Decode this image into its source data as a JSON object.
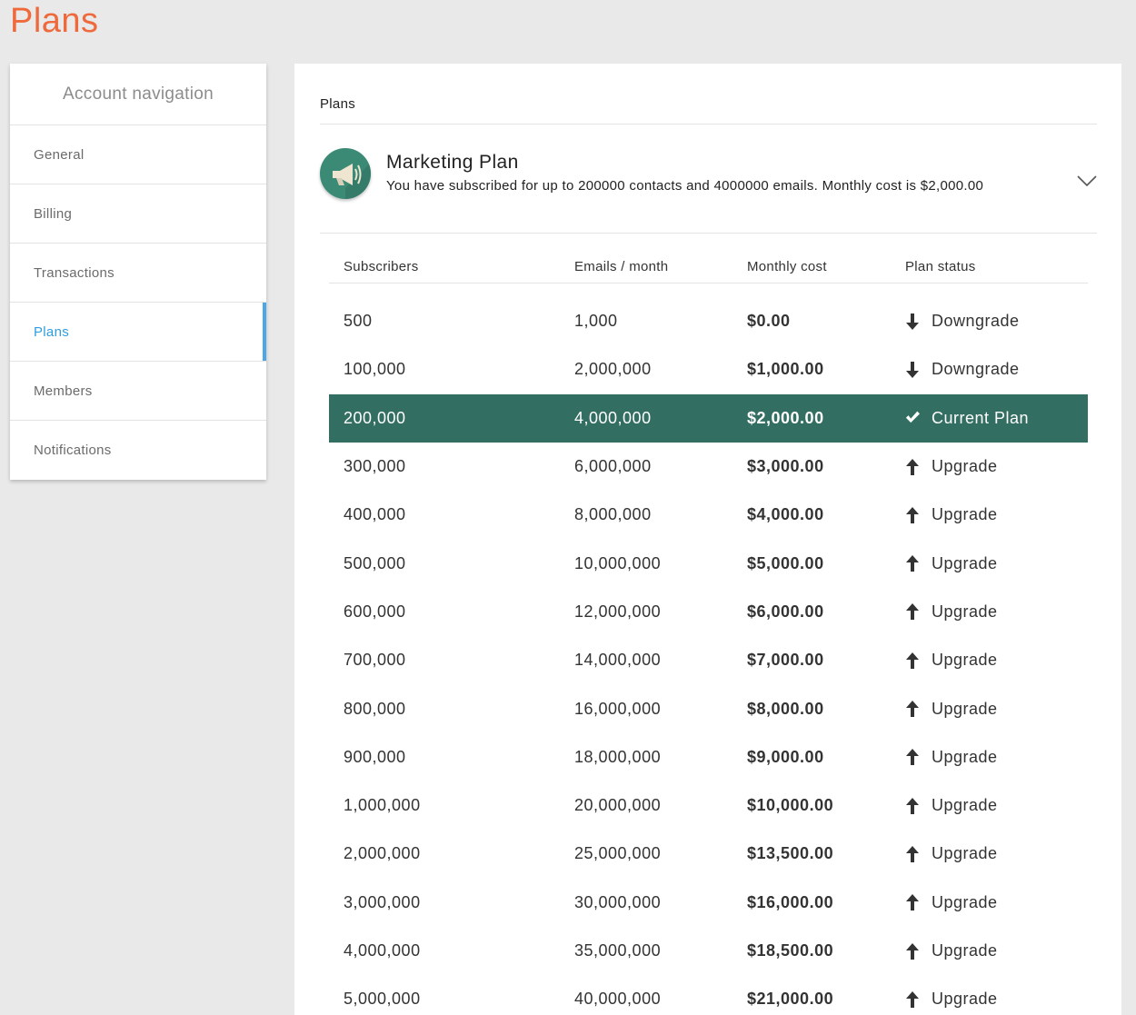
{
  "page": {
    "title": "Plans"
  },
  "sidebar": {
    "heading": "Account navigation",
    "items": [
      {
        "label": "General",
        "active": false
      },
      {
        "label": "Billing",
        "active": false
      },
      {
        "label": "Transactions",
        "active": false
      },
      {
        "label": "Plans",
        "active": true
      },
      {
        "label": "Members",
        "active": false
      },
      {
        "label": "Notifications",
        "active": false
      }
    ]
  },
  "panel": {
    "title": "Plans",
    "plan": {
      "icon": "megaphone-icon",
      "name": "Marketing Plan",
      "description": "You have subscribed for up to 200000 contacts and 4000000 emails. Monthly cost is $2,000.00"
    },
    "table": {
      "headers": {
        "subscribers": "Subscribers",
        "emails": "Emails / month",
        "cost": "Monthly cost",
        "status": "Plan status"
      },
      "rows": [
        {
          "subscribers": "500",
          "emails": "1,000",
          "cost": "$0.00",
          "status": "Downgrade",
          "kind": "down"
        },
        {
          "subscribers": "100,000",
          "emails": "2,000,000",
          "cost": "$1,000.00",
          "status": "Downgrade",
          "kind": "down"
        },
        {
          "subscribers": "200,000",
          "emails": "4,000,000",
          "cost": "$2,000.00",
          "status": "Current Plan",
          "kind": "current"
        },
        {
          "subscribers": "300,000",
          "emails": "6,000,000",
          "cost": "$3,000.00",
          "status": "Upgrade",
          "kind": "up"
        },
        {
          "subscribers": "400,000",
          "emails": "8,000,000",
          "cost": "$4,000.00",
          "status": "Upgrade",
          "kind": "up"
        },
        {
          "subscribers": "500,000",
          "emails": "10,000,000",
          "cost": "$5,000.00",
          "status": "Upgrade",
          "kind": "up"
        },
        {
          "subscribers": "600,000",
          "emails": "12,000,000",
          "cost": "$6,000.00",
          "status": "Upgrade",
          "kind": "up"
        },
        {
          "subscribers": "700,000",
          "emails": "14,000,000",
          "cost": "$7,000.00",
          "status": "Upgrade",
          "kind": "up"
        },
        {
          "subscribers": "800,000",
          "emails": "16,000,000",
          "cost": "$8,000.00",
          "status": "Upgrade",
          "kind": "up"
        },
        {
          "subscribers": "900,000",
          "emails": "18,000,000",
          "cost": "$9,000.00",
          "status": "Upgrade",
          "kind": "up"
        },
        {
          "subscribers": "1,000,000",
          "emails": "20,000,000",
          "cost": "$10,000.00",
          "status": "Upgrade",
          "kind": "up"
        },
        {
          "subscribers": "2,000,000",
          "emails": "25,000,000",
          "cost": "$13,500.00",
          "status": "Upgrade",
          "kind": "up"
        },
        {
          "subscribers": "3,000,000",
          "emails": "30,000,000",
          "cost": "$16,000.00",
          "status": "Upgrade",
          "kind": "up"
        },
        {
          "subscribers": "4,000,000",
          "emails": "35,000,000",
          "cost": "$18,500.00",
          "status": "Upgrade",
          "kind": "up"
        },
        {
          "subscribers": "5,000,000",
          "emails": "40,000,000",
          "cost": "$21,000.00",
          "status": "Upgrade",
          "kind": "up"
        }
      ]
    }
  },
  "colors": {
    "title": "#ee6a3c",
    "active_nav": "#2f9ee0",
    "current_row": "#336e62",
    "plan_icon_bg": "#3b8a75"
  }
}
